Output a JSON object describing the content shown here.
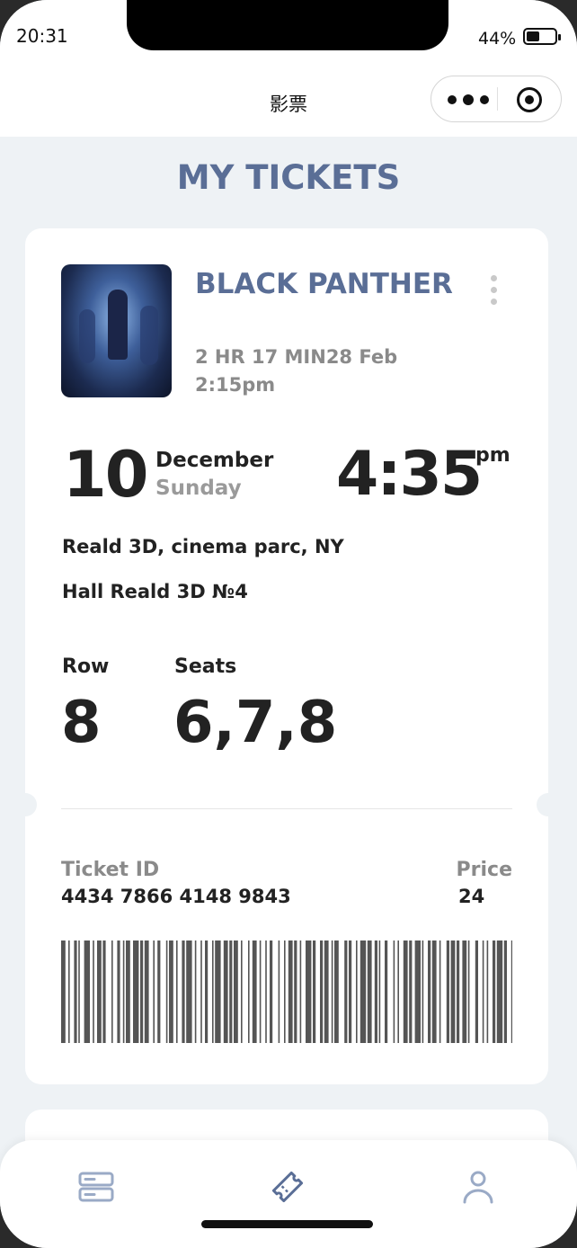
{
  "status_bar": {
    "time": "20:31",
    "battery": "44%"
  },
  "navbar": {
    "title": "影票"
  },
  "page": {
    "title": "MY TICKETS"
  },
  "ticket": {
    "movie_title": "BLACK PANTHER",
    "duration": "2 HR 17 MIN",
    "date_short": "28 Feb",
    "showtime_short": "2:15pm",
    "day": "10",
    "month": "December",
    "weekday": "Sunday",
    "time": "4:35",
    "ampm": "pm",
    "venue": "Reald 3D, cinema parc, NY",
    "hall": "Hall Reald 3D №4",
    "row_label": "Row",
    "row": "8",
    "seats_label": "Seats",
    "seats": "6,7,8",
    "ticket_id_label": "Ticket ID",
    "ticket_id": "4434 7866 4148 9843",
    "price_label": "Price",
    "price": "24"
  },
  "tabbar": {
    "items": [
      {
        "icon": "list-icon",
        "color": "#9aaac6"
      },
      {
        "icon": "ticket-icon",
        "color": "#5a6e96"
      },
      {
        "icon": "user-icon",
        "color": "#9aaac6"
      }
    ]
  },
  "colors": {
    "accent": "#5a6e96",
    "background": "#eef2f5",
    "card": "#ffffff",
    "muted": "#8a8a8a"
  }
}
